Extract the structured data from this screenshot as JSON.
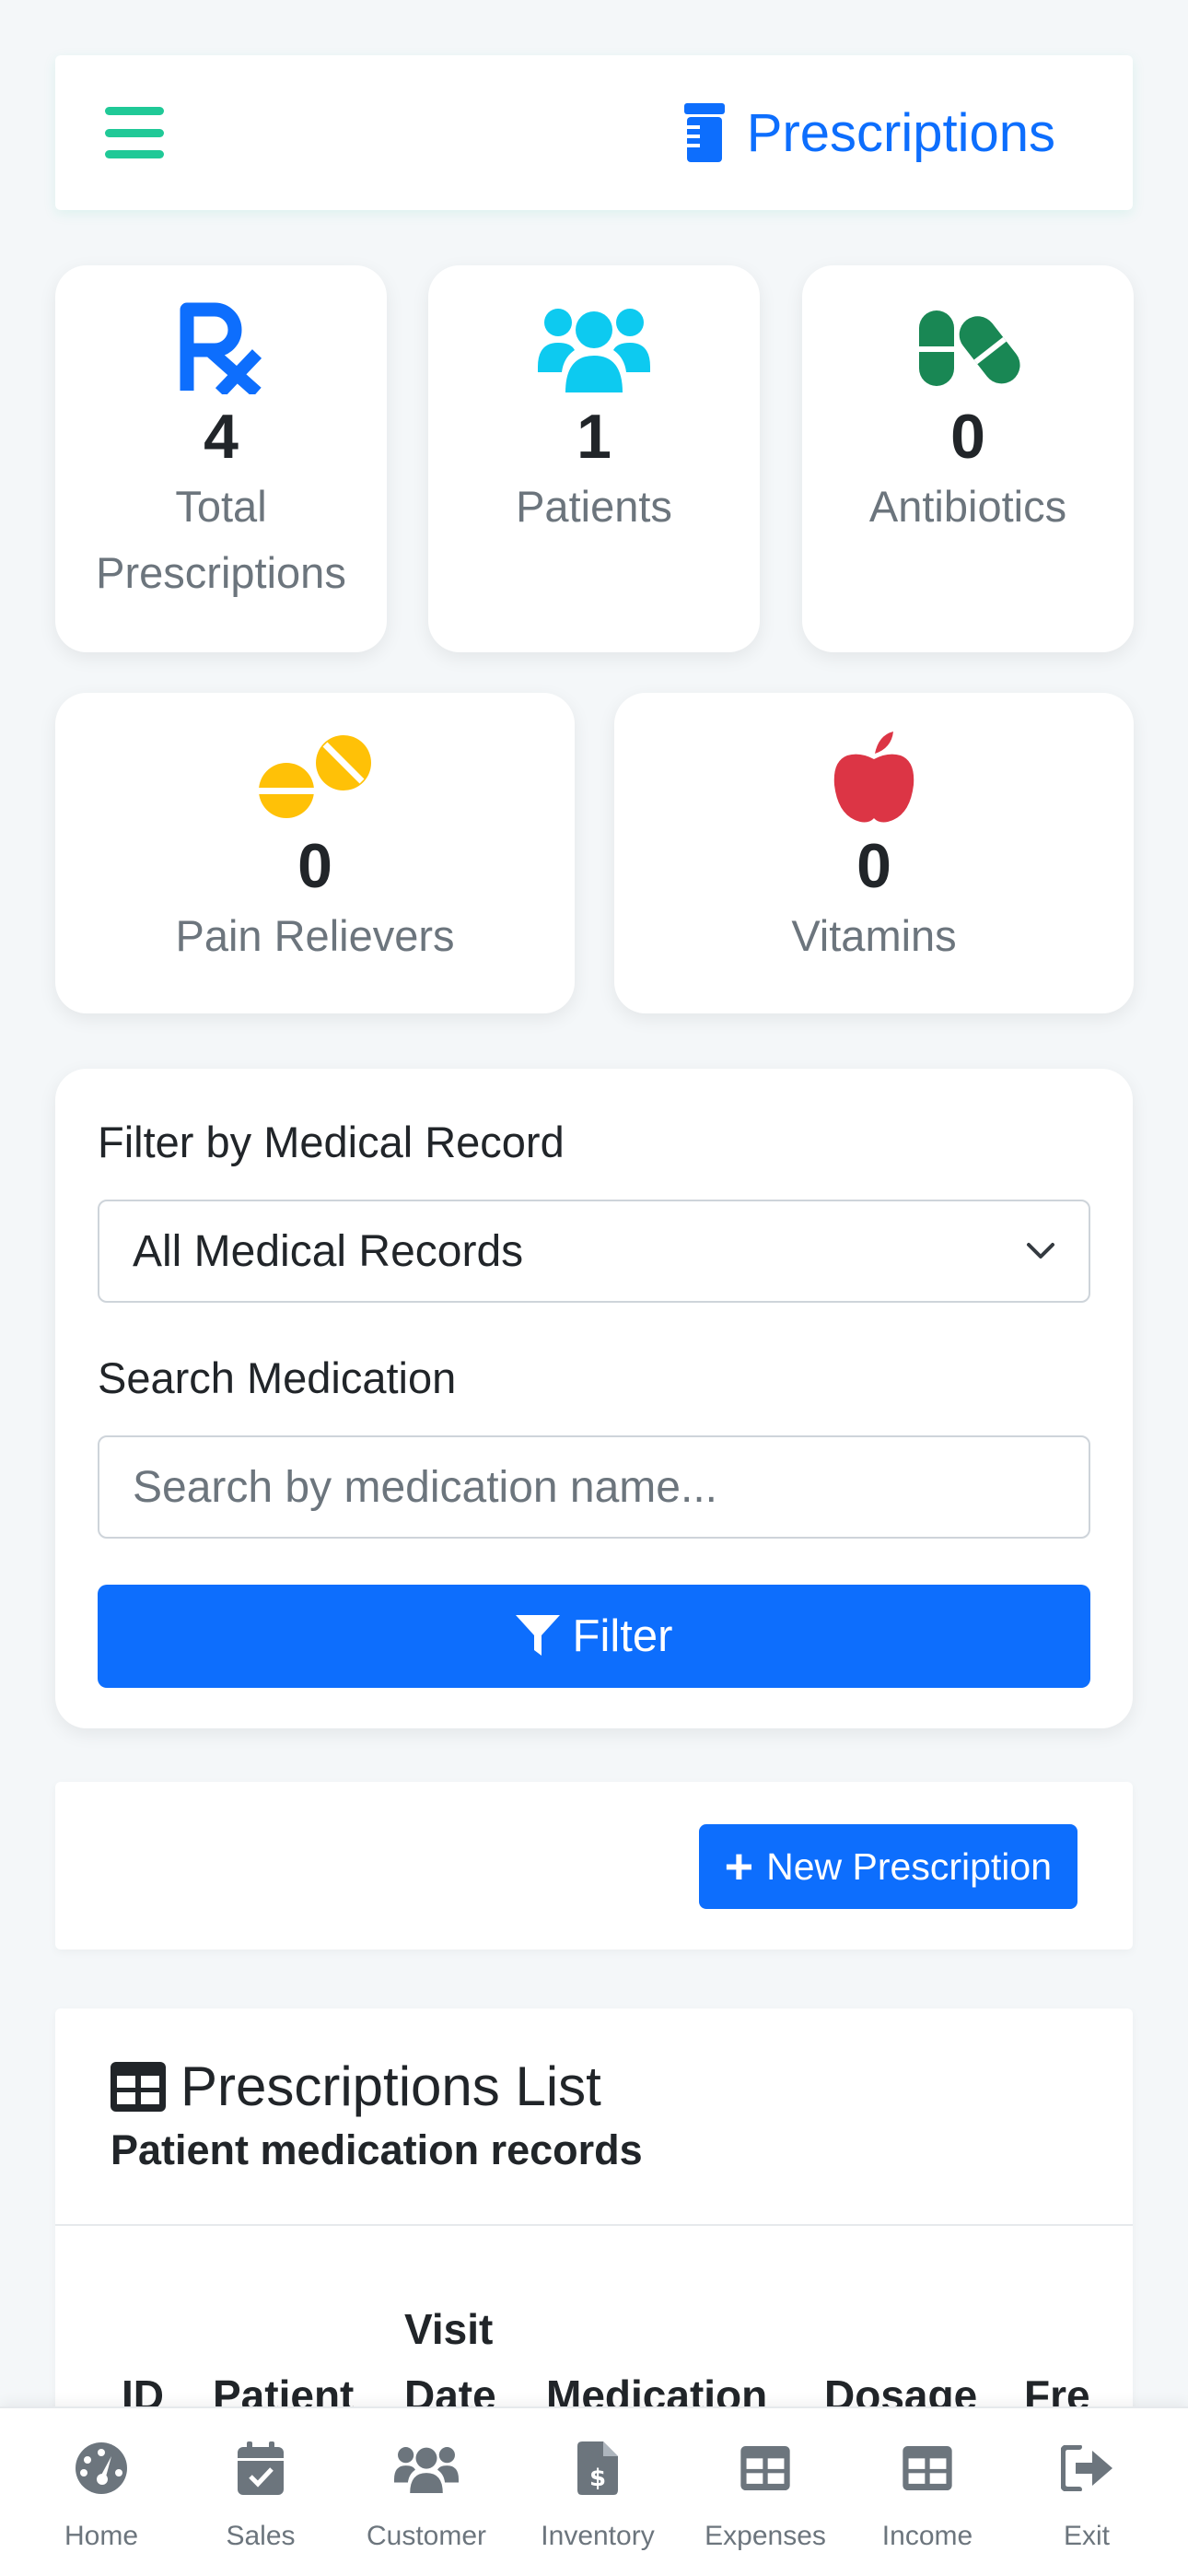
{
  "header": {
    "title": "Prescriptions"
  },
  "stats": [
    {
      "value": "4",
      "label": "Total Prescriptions",
      "icon": "rx-icon",
      "color": "#0d6efd"
    },
    {
      "value": "1",
      "label": "Patients",
      "icon": "users-icon",
      "color": "#0dcaf0"
    },
    {
      "value": "0",
      "label": "Antibiotics",
      "icon": "pills-icon",
      "color": "#198754"
    },
    {
      "value": "0",
      "label": "Pain Relievers",
      "icon": "tablets-icon",
      "color": "#ffc107"
    },
    {
      "value": "0",
      "label": "Vitamins",
      "icon": "apple-icon",
      "color": "#dc3545"
    }
  ],
  "filter": {
    "record_label": "Filter by Medical Record",
    "record_value": "All Medical Records",
    "search_label": "Search Medication",
    "search_placeholder": "Search by medication name...",
    "button": "Filter"
  },
  "actions": {
    "new_button": "New Prescription"
  },
  "list": {
    "title": "Prescriptions List",
    "subtitle": "Patient medication records",
    "columns": [
      "ID",
      "Patient",
      "Visit Date",
      "Medication",
      "Dosage",
      "Fre"
    ]
  },
  "nav": [
    {
      "label": "Home",
      "icon": "gauge-icon"
    },
    {
      "label": "Sales",
      "icon": "calendar-check-icon"
    },
    {
      "label": "Customer",
      "icon": "users-icon"
    },
    {
      "label": "Inventory",
      "icon": "invoice-dollar-icon"
    },
    {
      "label": "Expenses",
      "icon": "table-icon"
    },
    {
      "label": "Income",
      "icon": "table-icon"
    },
    {
      "label": "Exit",
      "icon": "sign-out-icon"
    }
  ],
  "colors": {
    "primary": "#0d6efd",
    "accent": "#20c997",
    "muted": "#6c757d"
  }
}
